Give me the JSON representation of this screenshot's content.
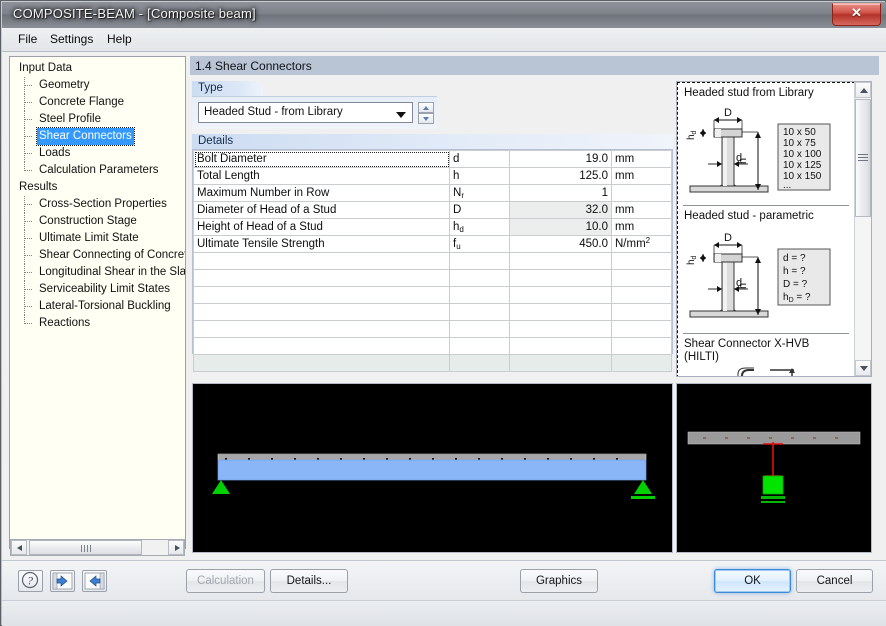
{
  "window": {
    "title": "COMPOSITE-BEAM - [Composite beam]",
    "close_label": "✕"
  },
  "menubar": {
    "items": [
      {
        "label": "File"
      },
      {
        "label": "Settings"
      },
      {
        "label": "Help"
      }
    ]
  },
  "sidebar": {
    "groups": [
      {
        "label": "Input Data",
        "items": [
          {
            "label": "Geometry",
            "selected": false
          },
          {
            "label": "Concrete Flange",
            "selected": false
          },
          {
            "label": "Steel Profile",
            "selected": false
          },
          {
            "label": "Shear Connectors",
            "selected": true
          },
          {
            "label": "Loads",
            "selected": false
          },
          {
            "label": "Calculation Parameters",
            "selected": false
          }
        ]
      },
      {
        "label": "Results",
        "items": [
          {
            "label": "Cross-Section Properties",
            "selected": false
          },
          {
            "label": "Construction Stage",
            "selected": false
          },
          {
            "label": "Ultimate Limit State",
            "selected": false
          },
          {
            "label": "Shear Connecting of Concrete F",
            "selected": false
          },
          {
            "label": "Longitudinal Shear in the Slab",
            "selected": false
          },
          {
            "label": "Serviceability Limit States",
            "selected": false
          },
          {
            "label": "Lateral-Torsional Buckling",
            "selected": false
          },
          {
            "label": "Reactions",
            "selected": false
          }
        ]
      }
    ]
  },
  "page": {
    "header": "1.4 Shear Connectors"
  },
  "type_group": {
    "legend": "Type",
    "selected": "Headed Stud - from Library"
  },
  "details_group": {
    "legend": "Details",
    "rows": [
      {
        "desc": "Bolt Diameter",
        "sym": "d",
        "sub": "",
        "val": "19.0",
        "unit": "mm",
        "unit_sup": "",
        "readonly": false,
        "focus": true
      },
      {
        "desc": "Total Length",
        "sym": "h",
        "sub": "",
        "val": "125.0",
        "unit": "mm",
        "unit_sup": "",
        "readonly": false,
        "focus": false
      },
      {
        "desc": "Maximum Number in Row",
        "sym": "N",
        "sub": "r",
        "val": "1",
        "unit": "",
        "unit_sup": "",
        "readonly": false,
        "focus": false
      },
      {
        "desc": "Diameter of Head of a Stud",
        "sym": "D",
        "sub": "",
        "val": "32.0",
        "unit": "mm",
        "unit_sup": "",
        "readonly": true,
        "focus": false
      },
      {
        "desc": "Height of Head of a Stud",
        "sym": "h",
        "sub": "d",
        "val": "10.0",
        "unit": "mm",
        "unit_sup": "",
        "readonly": true,
        "focus": false
      },
      {
        "desc": "Ultimate Tensile Strength",
        "sym": "f",
        "sub": "u",
        "val": "450.0",
        "unit": "N/mm",
        "unit_sup": "2",
        "readonly": false,
        "focus": false
      }
    ],
    "empty_rows": 6,
    "tail_rows": 1
  },
  "illustrations": {
    "sections": [
      {
        "title": "Headed stud from Library",
        "labels": {
          "D": "D",
          "h": "h",
          "d": "d",
          "hd": "h",
          "hd_sub": "d"
        },
        "list": [
          "10 x 50",
          "10 x 75",
          "10 x 100",
          "10 x 125",
          "10 x 150",
          "..."
        ]
      },
      {
        "title": "Headed stud - parametric",
        "labels": {
          "D": "D",
          "h": "h",
          "d": "d",
          "hd": "h",
          "hd_sub": "d"
        },
        "list": [
          "d   = ?",
          "h   = ?",
          "D   = ?",
          "hD  = ?"
        ]
      },
      {
        "title": "Shear Connector X-HVB",
        "title2": "(HILTI)"
      }
    ]
  },
  "toolbar": {
    "help_icon": "help-icon",
    "prev_icon": "back-arrow-icon",
    "next_icon": "forward-arrow-icon"
  },
  "buttons": {
    "calculation": "Calculation",
    "details": "Details...",
    "graphics": "Graphics",
    "ok": "OK",
    "cancel": "Cancel"
  },
  "colors": {
    "selection": "#3399ff",
    "header_bg": "#b9c4d4",
    "beam_fill": "#8ab6f7",
    "slab_fill": "#9a9a9a",
    "support": "#00d000",
    "stud_line": "#e01010",
    "view_bg": "#000000"
  }
}
